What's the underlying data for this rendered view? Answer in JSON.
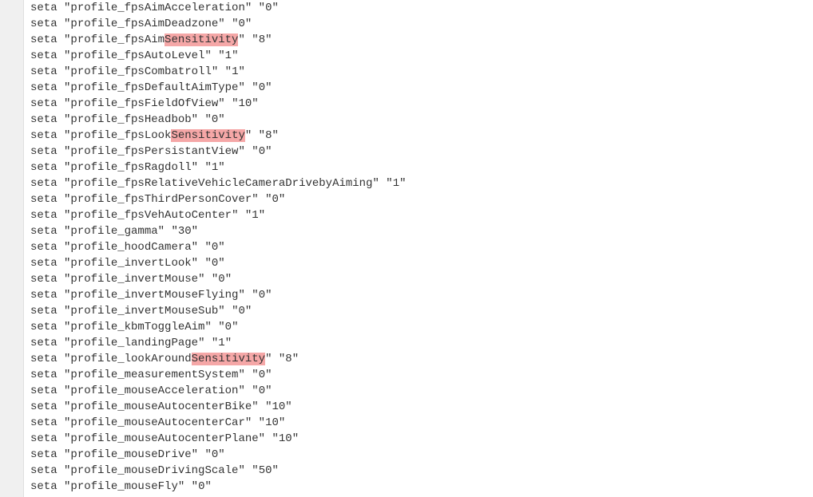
{
  "lines": [
    {
      "cmd": "seta",
      "key_before": "profile_fpsAimAcceleration",
      "key_hl": "",
      "key_after": "",
      "value": "0"
    },
    {
      "cmd": "seta",
      "key_before": "profile_fpsAimDeadzone",
      "key_hl": "",
      "key_after": "",
      "value": "0"
    },
    {
      "cmd": "seta",
      "key_before": "profile_fpsAim",
      "key_hl": "Sensitivity",
      "key_after": "",
      "value": "8"
    },
    {
      "cmd": "seta",
      "key_before": "profile_fpsAutoLevel",
      "key_hl": "",
      "key_after": "",
      "value": "1"
    },
    {
      "cmd": "seta",
      "key_before": "profile_fpsCombatroll",
      "key_hl": "",
      "key_after": "",
      "value": "1"
    },
    {
      "cmd": "seta",
      "key_before": "profile_fpsDefaultAimType",
      "key_hl": "",
      "key_after": "",
      "value": "0"
    },
    {
      "cmd": "seta",
      "key_before": "profile_fpsFieldOfView",
      "key_hl": "",
      "key_after": "",
      "value": "10"
    },
    {
      "cmd": "seta",
      "key_before": "profile_fpsHeadbob",
      "key_hl": "",
      "key_after": "",
      "value": "0"
    },
    {
      "cmd": "seta",
      "key_before": "profile_fpsLook",
      "key_hl": "Sensitivity",
      "key_after": "",
      "value": "8"
    },
    {
      "cmd": "seta",
      "key_before": "profile_fpsPersistantView",
      "key_hl": "",
      "key_after": "",
      "value": "0"
    },
    {
      "cmd": "seta",
      "key_before": "profile_fpsRagdoll",
      "key_hl": "",
      "key_after": "",
      "value": "1"
    },
    {
      "cmd": "seta",
      "key_before": "profile_fpsRelativeVehicleCameraDrivebyAiming",
      "key_hl": "",
      "key_after": "",
      "value": "1"
    },
    {
      "cmd": "seta",
      "key_before": "profile_fpsThirdPersonCover",
      "key_hl": "",
      "key_after": "",
      "value": "0"
    },
    {
      "cmd": "seta",
      "key_before": "profile_fpsVehAutoCenter",
      "key_hl": "",
      "key_after": "",
      "value": "1"
    },
    {
      "cmd": "seta",
      "key_before": "profile_gamma",
      "key_hl": "",
      "key_after": "",
      "value": "30"
    },
    {
      "cmd": "seta",
      "key_before": "profile_hoodCamera",
      "key_hl": "",
      "key_after": "",
      "value": "0"
    },
    {
      "cmd": "seta",
      "key_before": "profile_invertLook",
      "key_hl": "",
      "key_after": "",
      "value": "0"
    },
    {
      "cmd": "seta",
      "key_before": "profile_invertMouse",
      "key_hl": "",
      "key_after": "",
      "value": "0"
    },
    {
      "cmd": "seta",
      "key_before": "profile_invertMouseFlying",
      "key_hl": "",
      "key_after": "",
      "value": "0"
    },
    {
      "cmd": "seta",
      "key_before": "profile_invertMouseSub",
      "key_hl": "",
      "key_after": "",
      "value": "0"
    },
    {
      "cmd": "seta",
      "key_before": "profile_kbmToggleAim",
      "key_hl": "",
      "key_after": "",
      "value": "0"
    },
    {
      "cmd": "seta",
      "key_before": "profile_landingPage",
      "key_hl": "",
      "key_after": "",
      "value": "1"
    },
    {
      "cmd": "seta",
      "key_before": "profile_lookAround",
      "key_hl": "Sensitivity",
      "key_after": "",
      "value": "8"
    },
    {
      "cmd": "seta",
      "key_before": "profile_measurementSystem",
      "key_hl": "",
      "key_after": "",
      "value": "0"
    },
    {
      "cmd": "seta",
      "key_before": "profile_mouseAcceleration",
      "key_hl": "",
      "key_after": "",
      "value": "0"
    },
    {
      "cmd": "seta",
      "key_before": "profile_mouseAutocenterBike",
      "key_hl": "",
      "key_after": "",
      "value": "10"
    },
    {
      "cmd": "seta",
      "key_before": "profile_mouseAutocenterCar",
      "key_hl": "",
      "key_after": "",
      "value": "10"
    },
    {
      "cmd": "seta",
      "key_before": "profile_mouseAutocenterPlane",
      "key_hl": "",
      "key_after": "",
      "value": "10"
    },
    {
      "cmd": "seta",
      "key_before": "profile_mouseDrive",
      "key_hl": "",
      "key_after": "",
      "value": "0"
    },
    {
      "cmd": "seta",
      "key_before": "profile_mouseDrivingScale",
      "key_hl": "",
      "key_after": "",
      "value": "50"
    },
    {
      "cmd": "seta",
      "key_before": "profile_mouseFly",
      "key_hl": "",
      "key_after": "",
      "value": "0"
    }
  ]
}
